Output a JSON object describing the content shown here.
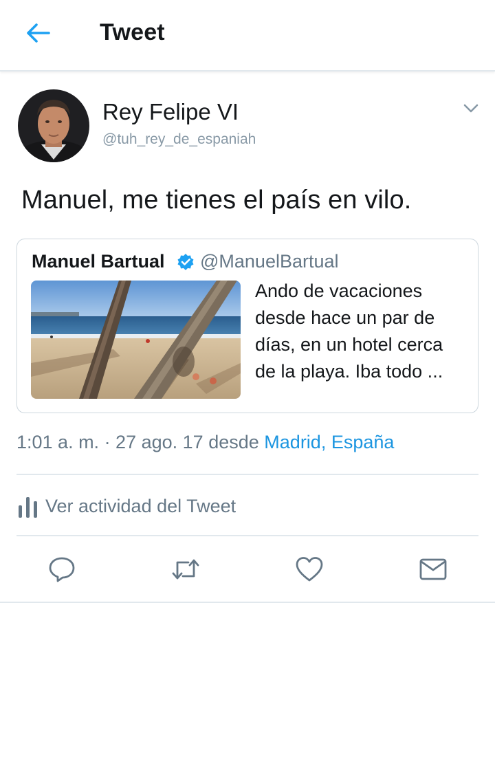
{
  "header": {
    "title": "Tweet",
    "back_icon": "arrow-left-icon",
    "accent_color": "#1da1f2"
  },
  "tweet": {
    "author_name": "Rey Felipe VI",
    "author_handle": "@tuh_rey_de_espaniah",
    "text": "Manuel, me tienes el país en vilo.",
    "quoted": {
      "name": "Manuel Bartual",
      "verified": true,
      "handle": "@ManuelBartual",
      "text": "Ando de vacaciones desde hace un par de días, en un hotel cerca de la playa. Iba todo ..."
    },
    "timestamp": "1:01 a. m. · 27 ago. 17",
    "source_prefix": "desde",
    "location": "Madrid, España",
    "link_color": "#1b95e0"
  },
  "activity": {
    "label": "Ver actividad del Tweet",
    "icon": "bar-chart-icon"
  },
  "actions": [
    {
      "name": "reply",
      "icon": "reply-icon"
    },
    {
      "name": "retweet",
      "icon": "retweet-icon"
    },
    {
      "name": "like",
      "icon": "heart-icon"
    },
    {
      "name": "message",
      "icon": "envelope-icon"
    }
  ]
}
